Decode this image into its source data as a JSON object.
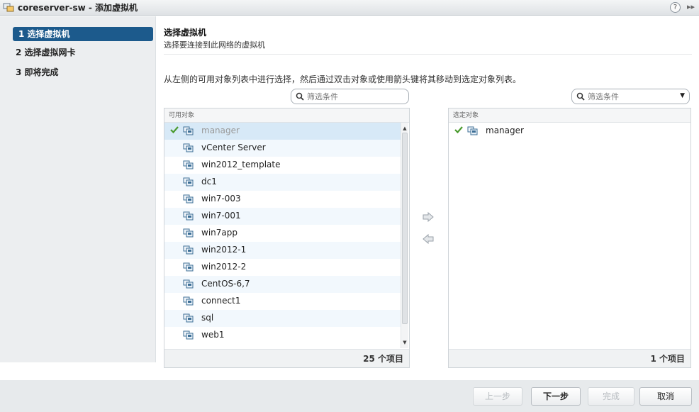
{
  "window": {
    "title": "coreserver-sw - 添加虚拟机"
  },
  "steps": [
    {
      "label": "1  选择虚拟机",
      "active": true
    },
    {
      "label": "2  选择虚拟网卡",
      "active": false
    },
    {
      "label": "3  即将完成",
      "active": false
    }
  ],
  "header": {
    "title": "选择虚拟机",
    "subtitle": "选择要连接到此网络的虚拟机"
  },
  "instruction": "从左侧的可用对象列表中进行选择，然后通过双击对象或使用箭头键将其移动到选定对象列表。",
  "left_filter": {
    "placeholder": "筛选条件"
  },
  "right_filter": {
    "placeholder": "筛选条件"
  },
  "available": {
    "header": "可用对象",
    "items": [
      {
        "label": "manager",
        "selected": true
      },
      {
        "label": "vCenter Server"
      },
      {
        "label": "win2012_template"
      },
      {
        "label": "dc1"
      },
      {
        "label": "win7-003"
      },
      {
        "label": "win7-001"
      },
      {
        "label": "win7app"
      },
      {
        "label": "win2012-1"
      },
      {
        "label": "win2012-2"
      },
      {
        "label": "CentOS-6,7"
      },
      {
        "label": "connect1"
      },
      {
        "label": "sql"
      },
      {
        "label": "web1"
      }
    ],
    "count_label": "25 个项目"
  },
  "selected": {
    "header": "选定对象",
    "items": [
      {
        "label": "manager"
      }
    ],
    "count_label": "1 个项目"
  },
  "buttons": {
    "back": "上一步",
    "next": "下一步",
    "finish": "完成",
    "cancel": "取消"
  },
  "colors": {
    "active_step": "#1c5a8c",
    "check": "#4a9a2e",
    "row_alt": "#f2f8fd",
    "row_selected": "#d7e9f7"
  }
}
